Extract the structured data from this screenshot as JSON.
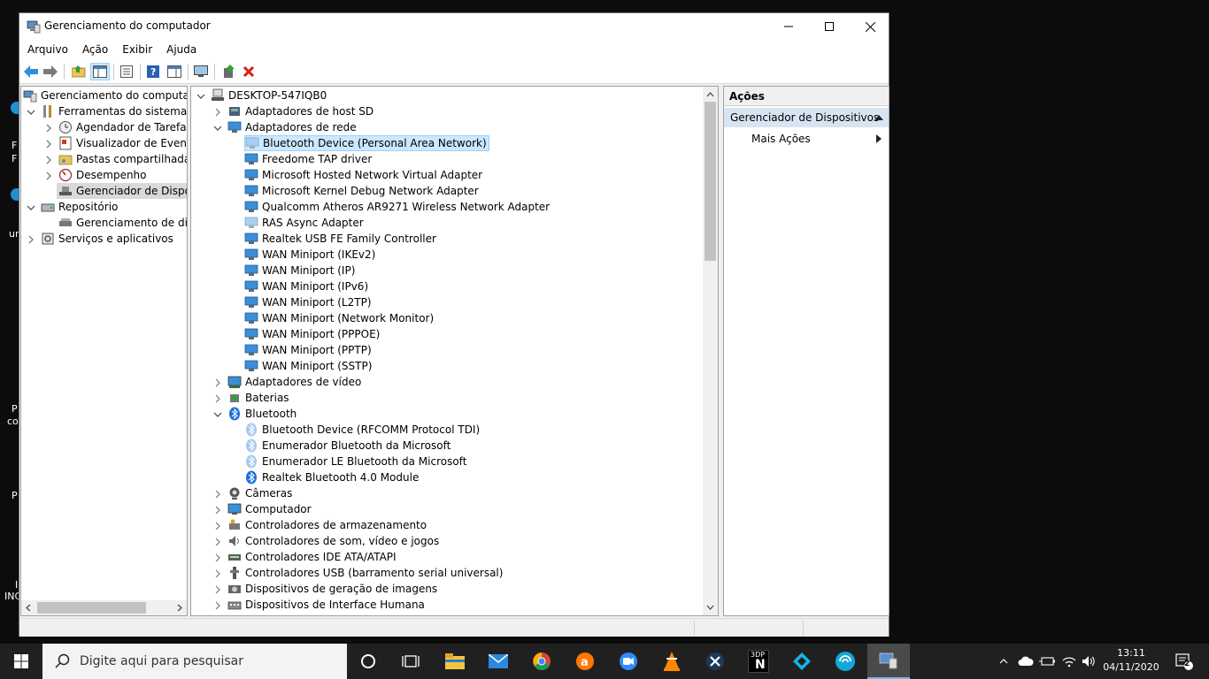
{
  "window": {
    "title": "Gerenciamento do computador",
    "menu": [
      "Arquivo",
      "Ação",
      "Exibir",
      "Ajuda"
    ]
  },
  "left_tree": [
    {
      "label": "Gerenciamento do computado",
      "icon": "computer-management-icon"
    },
    {
      "label": "Ferramentas do sistema",
      "icon": "system-tools-icon"
    },
    {
      "label": "Agendador de Tarefas",
      "icon": "clock-icon"
    },
    {
      "label": "Visualizador de Eventos",
      "icon": "event-viewer-icon"
    },
    {
      "label": "Pastas compartilhadas",
      "icon": "shared-folder-icon"
    },
    {
      "label": "Desempenho",
      "icon": "performance-icon"
    },
    {
      "label": "Gerenciador de Disposit",
      "icon": "device-manager-icon"
    },
    {
      "label": "Repositório",
      "icon": "storage-icon"
    },
    {
      "label": "Gerenciamento de disco",
      "icon": "disk-icon"
    },
    {
      "label": "Serviços e aplicativos",
      "icon": "services-icon"
    }
  ],
  "device_tree": {
    "root": "DESKTOP-547IQB0",
    "items": [
      {
        "label": "Adaptadores de host SD"
      },
      {
        "label": "Adaptadores de rede"
      },
      {
        "label": "Bluetooth Device (Personal Area Network)"
      },
      {
        "label": "Freedome TAP driver"
      },
      {
        "label": "Microsoft Hosted Network Virtual Adapter"
      },
      {
        "label": "Microsoft Kernel Debug Network Adapter"
      },
      {
        "label": "Qualcomm Atheros AR9271 Wireless Network Adapter"
      },
      {
        "label": "RAS Async Adapter"
      },
      {
        "label": "Realtek USB FE Family Controller"
      },
      {
        "label": "WAN Miniport (IKEv2)"
      },
      {
        "label": "WAN Miniport (IP)"
      },
      {
        "label": "WAN Miniport (IPv6)"
      },
      {
        "label": "WAN Miniport (L2TP)"
      },
      {
        "label": "WAN Miniport (Network Monitor)"
      },
      {
        "label": "WAN Miniport (PPPOE)"
      },
      {
        "label": "WAN Miniport (PPTP)"
      },
      {
        "label": "WAN Miniport (SSTP)"
      },
      {
        "label": "Adaptadores de vídeo"
      },
      {
        "label": "Baterias"
      },
      {
        "label": "Bluetooth"
      },
      {
        "label": "Bluetooth Device (RFCOMM Protocol TDI)"
      },
      {
        "label": "Enumerador Bluetooth da Microsoft"
      },
      {
        "label": "Enumerador LE Bluetooth da Microsoft"
      },
      {
        "label": "Realtek Bluetooth 4.0 Module"
      },
      {
        "label": "Câmeras"
      },
      {
        "label": "Computador"
      },
      {
        "label": "Controladores de armazenamento"
      },
      {
        "label": "Controladores de som, vídeo e jogos"
      },
      {
        "label": "Controladores IDE ATA/ATAPI"
      },
      {
        "label": "Controladores USB (barramento serial universal)"
      },
      {
        "label": "Dispositivos de geração de imagens"
      },
      {
        "label": "Dispositivos de Interface Humana"
      }
    ]
  },
  "actions": {
    "header": "Ações",
    "section": "Gerenciador de Dispositivos",
    "more": "Mais Ações"
  },
  "taskbar": {
    "search_placeholder": "Digite aqui para pesquisar",
    "time": "13:11",
    "date": "04/11/2020",
    "notifications": "2",
    "tile_3dp_top": "3DP",
    "tile_3dp_bottom": "N"
  },
  "desktop_fragments": [
    "F",
    "F",
    "ur",
    "P",
    "co",
    "P",
    "I",
    "INC"
  ],
  "colors": {
    "selection_blue": "#cce8ff",
    "accent": "#0078d7",
    "taskbar": "#202020"
  }
}
